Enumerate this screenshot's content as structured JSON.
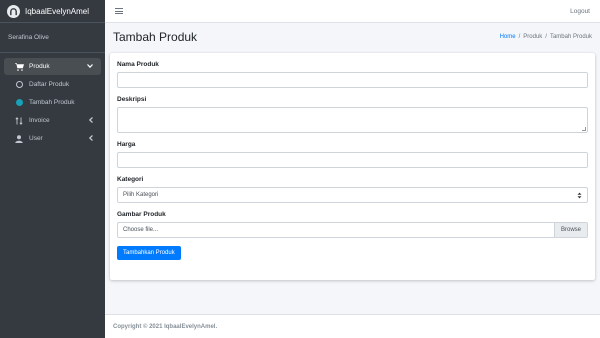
{
  "brand": {
    "name": "IqbaalEvelynAmel",
    "logo_icon": "circle-logo-icon"
  },
  "user": {
    "name": "Serafina Olive"
  },
  "sidebar": {
    "items": [
      {
        "label": "Produk",
        "icon": "cart-icon",
        "active": true,
        "chevron": "chevron-down-icon"
      },
      {
        "label": "Daftar Produk",
        "icon": "circle-outline-icon"
      },
      {
        "label": "Tambah Produk",
        "icon": "circle-filled-icon"
      },
      {
        "label": "Invoice",
        "icon": "sort-icon",
        "chevron": "chevron-left-icon"
      },
      {
        "label": "User",
        "icon": "user-icon",
        "chevron": "chevron-left-icon"
      }
    ]
  },
  "topbar": {
    "logout_label": "Logout"
  },
  "header": {
    "title": "Tambah Produk"
  },
  "breadcrumb": {
    "home": "Home",
    "sep": "/",
    "section": "Produk",
    "current": "Tambah Produk"
  },
  "form": {
    "nama_label": "Nama Produk",
    "deskripsi_label": "Deskripsi",
    "harga_label": "Harga",
    "kategori_label": "Kategori",
    "kategori_selected": "Pilih Kategori",
    "gambar_label": "Gambar Produk",
    "file_placeholder": "Choose file...",
    "browse_label": "Browse",
    "submit_label": "Tambahkan Produk"
  },
  "footer": {
    "text": "Copyright © 2021 IqbaalEvelynAmel."
  },
  "colors": {
    "sidebar_bg": "#343a40",
    "primary": "#007bff",
    "active_dot": "#17a2b8",
    "content_bg": "#f4f6f9"
  }
}
